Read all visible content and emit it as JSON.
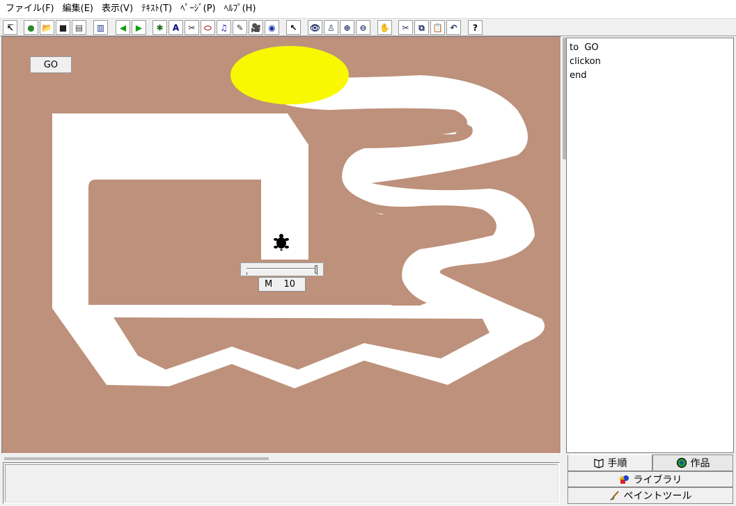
{
  "menu": [
    "ファイル(F)",
    "編集(E)",
    "表示(V)",
    "ﾃｷｽﾄ(T)",
    "ﾍﾟｰｼﾞ(P)",
    "ﾍﾙﾌﾟ(H)"
  ],
  "toolbar": {
    "buttons": [
      {
        "name": "select-arrow-icon",
        "glyph": "↸",
        "color": "#000000"
      },
      {
        "name": "new-project-icon",
        "glyph": "●",
        "color": "#2a8a2a"
      },
      {
        "name": "open-folder-icon",
        "glyph": "📂",
        "color": "#c8a000"
      },
      {
        "name": "save-disk-icon",
        "glyph": "■",
        "color": "#202020"
      },
      {
        "name": "print-icon",
        "glyph": "▤",
        "color": "#404040"
      },
      {
        "name": "pages-icon",
        "glyph": "▥",
        "color": "#1a3a8a"
      },
      {
        "name": "prev-page-icon",
        "glyph": "◀",
        "color": "#10a010"
      },
      {
        "name": "next-page-icon",
        "glyph": "▶",
        "color": "#10a010"
      },
      {
        "name": "new-turtle-icon",
        "glyph": "✱",
        "color": "#1a6a1a"
      },
      {
        "name": "text-box-icon",
        "glyph": "A",
        "color": "#000080"
      },
      {
        "name": "new-button-icon",
        "glyph": "✂",
        "color": "#303030"
      },
      {
        "name": "slider-icon",
        "glyph": "⬭",
        "color": "#a01010"
      },
      {
        "name": "music-icon",
        "glyph": "♫",
        "color": "#1010a0"
      },
      {
        "name": "tool-icon",
        "glyph": "✎",
        "color": "#303030"
      },
      {
        "name": "video-icon",
        "glyph": "🎥",
        "color": "#303030"
      },
      {
        "name": "record-icon",
        "glyph": "◉",
        "color": "#1030a0"
      },
      {
        "name": "pointer-icon",
        "glyph": "↖",
        "color": "#000000"
      },
      {
        "name": "eye-icon",
        "glyph": "👁",
        "color": "#203060"
      },
      {
        "name": "stamp-icon",
        "glyph": "♙",
        "color": "#203060"
      },
      {
        "name": "zoom-in-icon",
        "glyph": "⊕",
        "color": "#203060"
      },
      {
        "name": "zoom-out-icon",
        "glyph": "⊖",
        "color": "#203060"
      },
      {
        "name": "stop-hand-icon",
        "glyph": "✋",
        "color": "#c01010"
      },
      {
        "name": "cut-icon",
        "glyph": "✂",
        "color": "#203060"
      },
      {
        "name": "copy-icon",
        "glyph": "⧉",
        "color": "#203060"
      },
      {
        "name": "paste-icon",
        "glyph": "📋",
        "color": "#806010"
      },
      {
        "name": "undo-icon",
        "glyph": "↶",
        "color": "#203060"
      },
      {
        "name": "help-icon",
        "glyph": "?",
        "color": "#000000"
      }
    ]
  },
  "canvas": {
    "background": "#bd917b",
    "go_button": "GO",
    "slider": {
      "name": "M",
      "value": "10",
      "level": 1.0
    }
  },
  "procedures": {
    "lines": [
      "to  GO",
      "clickon",
      "end"
    ]
  },
  "tabs": {
    "procedures": "手順",
    "works": "作品",
    "library": "ライブラリ",
    "paint": "ペイントツール"
  }
}
